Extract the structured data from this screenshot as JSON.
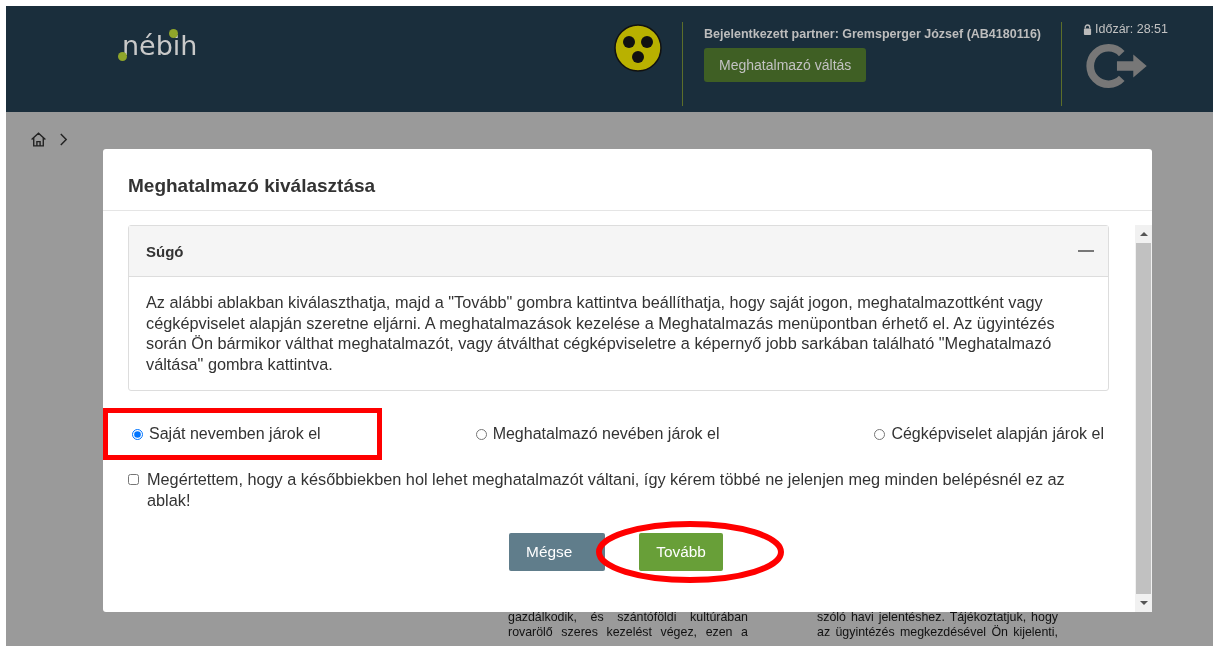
{
  "header": {
    "logo": "nébih",
    "partner_label": "Bejelentkezett partner: Gremsperger József (AB4180116)",
    "switch_button": "Meghatalmazó váltás",
    "timer": "Időzár: 28:51"
  },
  "background_text": {
    "column_1": [
      "gazdálkodik, és szántóföldi kultúrában",
      "rovarölő szeres kezelést végez, ezen a"
    ],
    "column_2": [
      "szóló havi jelentéshez. Tájékoztatjuk, hogy",
      "az ügyintézés megkezdésével Ön kijelenti,"
    ]
  },
  "modal": {
    "title": "Meghatalmazó kiválasztása",
    "help": {
      "title": "Súgó",
      "expanded": true,
      "text": "Az alábbi ablakban kiválaszthatja, majd a \"Tovább\" gombra kattintva beállíthatja, hogy saját jogon, meghatalmazottként vagy cégképviselet alapján szeretne eljárni. A meghatalmazások kezelése a Meghatalmazás menüpontban érhető el. Az ügyintézés során Ön bármikor válthat meghatalmazót, vagy átválthat cégképviseletre a képernyő jobb sarkában található \"Meghatalmazó váltása\" gombra kattintva."
    },
    "options": [
      {
        "label": "Saját nevemben járok el",
        "selected": true,
        "highlighted": true
      },
      {
        "label": "Meghatalmazó nevében járok el",
        "selected": false,
        "highlighted": false
      },
      {
        "label": "Cégképviselet alapján járok el",
        "selected": false,
        "highlighted": false
      }
    ],
    "dont_show_again": {
      "label": "Megértettem, hogy a későbbiekben hol lehet meghatalmazót váltani, így kérem többé ne jelenjen meg minden belépésnél ez az ablak!",
      "checked": false
    },
    "buttons": [
      {
        "label": "Mégse",
        "kind": "secondary",
        "highlighted": false
      },
      {
        "label": "Tovább",
        "kind": "primary",
        "highlighted": true
      }
    ]
  }
}
